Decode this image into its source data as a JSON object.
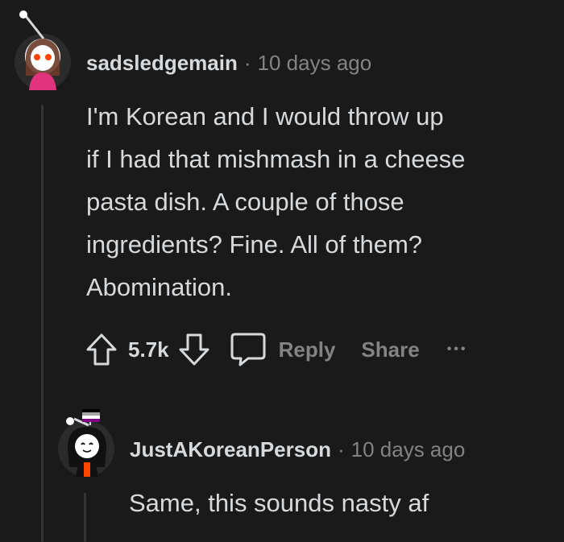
{
  "comment1": {
    "username": "sadsledgemain",
    "time": "10 days ago",
    "lines": [
      "I'm Korean and I would throw up",
      "if I had that mishmash in a cheese",
      "pasta dish. A couple of those",
      "ingredients? Fine. All of them?",
      "Abomination."
    ],
    "score": "5.7k",
    "reply_label": "Reply",
    "share_label": "Share",
    "more_label": "•••"
  },
  "comment2": {
    "username": "JustAKoreanPerson",
    "time": "10 days ago",
    "text": "Same, this sounds nasty af"
  },
  "colors": {
    "background": "#1a1a1b",
    "text": "#d7dadc",
    "muted": "#818384",
    "thread_line": "#343536"
  },
  "icons": [
    "upvote-icon",
    "downvote-icon",
    "comment-icon",
    "more-icon",
    "snoo-antenna-icon",
    "ace-flag-icon"
  ]
}
